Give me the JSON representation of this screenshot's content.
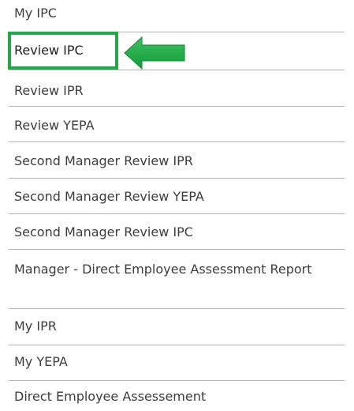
{
  "menu": {
    "items": [
      {
        "label": "My IPC"
      },
      {
        "label": "Review IPC"
      },
      {
        "label": "Review IPR"
      },
      {
        "label": "Review YEPA"
      },
      {
        "label": "Second Manager Review IPR"
      },
      {
        "label": "Second Manager Review YEPA"
      },
      {
        "label": "Second Manager Review IPC"
      },
      {
        "label": "Manager - Direct Employee Assessment Report"
      },
      {
        "label": "My IPR"
      },
      {
        "label": "My YEPA"
      },
      {
        "label": "Direct Employee Assessement"
      }
    ],
    "selected_index": 1
  },
  "colors": {
    "highlight": "#22a84a",
    "text": "#3d3d3d",
    "divider": "#b3b3b3"
  },
  "icons": {
    "pointer": "left-arrow-icon"
  }
}
